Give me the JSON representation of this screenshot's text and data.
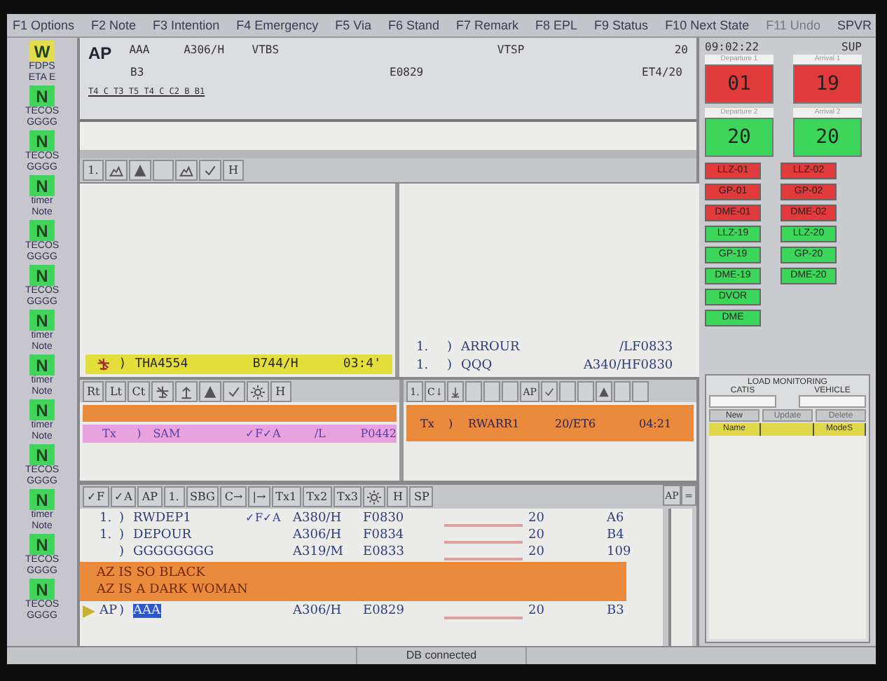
{
  "menu": [
    {
      "label": "F1 Options",
      "disabled": false
    },
    {
      "label": "F2 Note",
      "disabled": false
    },
    {
      "label": "F3 Intention",
      "disabled": false
    },
    {
      "label": "F4 Emergency",
      "disabled": false
    },
    {
      "label": "F5 Via",
      "disabled": false
    },
    {
      "label": "F6 Stand",
      "disabled": false
    },
    {
      "label": "F7 Remark",
      "disabled": false
    },
    {
      "label": "F8 EPL",
      "disabled": false
    },
    {
      "label": "F9 Status",
      "disabled": false
    },
    {
      "label": "F10 Next State",
      "disabled": false
    },
    {
      "label": "F11 Undo",
      "disabled": true
    },
    {
      "label": "SPVR",
      "disabled": false
    }
  ],
  "strips": [
    {
      "badge": "W",
      "color": "#e4dc4c",
      "line1": "FDPS",
      "line2": "ETA E"
    },
    {
      "badge": "N",
      "color": "#3fd45a",
      "line1": "TECOS",
      "line2": "GGGG"
    },
    {
      "badge": "N",
      "color": "#3fd45a",
      "line1": "TECOS",
      "line2": "GGGG"
    },
    {
      "badge": "N",
      "color": "#3fd45a",
      "line1": "timer",
      "line2": "Note"
    },
    {
      "badge": "N",
      "color": "#3fd45a",
      "line1": "TECOS",
      "line2": "GGGG"
    },
    {
      "badge": "N",
      "color": "#3fd45a",
      "line1": "TECOS",
      "line2": "GGGG"
    },
    {
      "badge": "N",
      "color": "#3fd45a",
      "line1": "timer",
      "line2": "Note"
    },
    {
      "badge": "N",
      "color": "#3fd45a",
      "line1": "timer",
      "line2": "Note"
    },
    {
      "badge": "N",
      "color": "#3fd45a",
      "line1": "timer",
      "line2": "Note"
    },
    {
      "badge": "N",
      "color": "#3fd45a",
      "line1": "TECOS",
      "line2": "GGGG"
    },
    {
      "badge": "N",
      "color": "#3fd45a",
      "line1": "timer",
      "line2": "Note"
    },
    {
      "badge": "N",
      "color": "#3fd45a",
      "line1": "TECOS",
      "line2": "GGGG"
    },
    {
      "badge": "N",
      "color": "#3fd45a",
      "line1": "TECOS",
      "line2": "GGGG"
    }
  ],
  "header": {
    "ap": "AP",
    "callsign": "AAA",
    "type": "A306/H",
    "origin": "VTBS",
    "dest": "VTSP",
    "runway": "20",
    "stand": "B3",
    "eobt": "E0829",
    "state": "ET4/20",
    "route": "T4_C_T3_T5_T4_C_C2_B_B1"
  },
  "toolbar_top": [
    {
      "kind": "text",
      "label": "1."
    },
    {
      "kind": "mountain"
    },
    {
      "kind": "triangle"
    },
    {
      "kind": "blank"
    },
    {
      "kind": "mountain"
    },
    {
      "kind": "check"
    },
    {
      "kind": "text",
      "label": "H"
    }
  ],
  "arrival_strip": {
    "mark": ")",
    "callsign": "THA4554",
    "type": "B744/H",
    "time": "03:4'"
  },
  "sequence_rows": [
    {
      "seq": "1.",
      "mark": ")",
      "callsign": "ARROUR",
      "type": "/L",
      "flight_level": "F0833"
    },
    {
      "seq": "1.",
      "mark": ")",
      "callsign": "QQQ",
      "type": "A340/H",
      "flight_level": "F0830"
    }
  ],
  "toolbar_left": [
    {
      "kind": "text",
      "label": "Rt"
    },
    {
      "kind": "text",
      "label": "Lt"
    },
    {
      "kind": "text",
      "label": "Ct"
    },
    {
      "kind": "cross"
    },
    {
      "kind": "arrow-up"
    },
    {
      "kind": "triangle"
    },
    {
      "kind": "check"
    },
    {
      "kind": "sun"
    },
    {
      "kind": "text",
      "label": "H"
    }
  ],
  "toolbar_right": [
    {
      "kind": "text",
      "label": "1."
    },
    {
      "kind": "text",
      "label": "C↓"
    },
    {
      "kind": "arrow-down"
    },
    {
      "kind": "blank"
    },
    {
      "kind": "blank"
    },
    {
      "kind": "blank"
    },
    {
      "kind": "text",
      "label": "AP"
    },
    {
      "kind": "check"
    },
    {
      "kind": "blank"
    },
    {
      "kind": "blank"
    },
    {
      "kind": "triangle"
    },
    {
      "kind": "blank"
    },
    {
      "kind": "blank"
    }
  ],
  "tx_left": {
    "mode": "Tx",
    "mark": ")",
    "callsign": "SAM",
    "flags": "✓F✓A",
    "type": "/L",
    "slot": "P0442"
  },
  "tx_right": {
    "mode": "Tx",
    "mark": ")",
    "callsign": "RWARR1",
    "state": "20/ET6",
    "time": "04:21"
  },
  "toolbar_bottom": [
    {
      "kind": "text",
      "label": "✓F"
    },
    {
      "kind": "text",
      "label": "✓A"
    },
    {
      "kind": "text",
      "label": "AP"
    },
    {
      "kind": "text",
      "label": "1."
    },
    {
      "kind": "text",
      "label": "SBG"
    },
    {
      "kind": "text",
      "label": "C→"
    },
    {
      "kind": "text",
      "label": "|→"
    },
    {
      "kind": "text",
      "label": "Tx1"
    },
    {
      "kind": "text",
      "label": "Tx2"
    },
    {
      "kind": "text",
      "label": "Tx3"
    },
    {
      "kind": "sun"
    },
    {
      "kind": "text",
      "label": "H"
    },
    {
      "kind": "text",
      "label": "SP"
    }
  ],
  "departures": [
    {
      "kind": "flight",
      "selected": false,
      "seq": "1.",
      "mark": ")",
      "callsign": "RWDEP1",
      "flags": "✓F✓A",
      "type": "A380/H",
      "time": "F0830",
      "runway": "20",
      "stand": "A6"
    },
    {
      "kind": "flight",
      "selected": false,
      "seq": "1.",
      "mark": ")",
      "callsign": "DEPOUR",
      "type": "A306/H",
      "time": "F0834",
      "runway": "20",
      "stand": "B4"
    },
    {
      "kind": "flight",
      "selected": false,
      "mark": ")",
      "callsign": "GGGGGGGG",
      "type": "A319/M",
      "time": "E0833",
      "runway": "20",
      "stand": "109"
    },
    {
      "kind": "remark",
      "lines": [
        "AZ IS SO BLACK",
        "AZ IS A DARK WOMAN"
      ]
    },
    {
      "kind": "flight",
      "selected": true,
      "seq": "AP",
      "mark": ")",
      "callsign": "AAA",
      "type": "A306/H",
      "time": "E0829",
      "runway": "20",
      "stand": "B3"
    }
  ],
  "side_buttons": [
    "AP",
    "="
  ],
  "status_panel": {
    "clock": "09:02:22",
    "role": "SUP",
    "runways": [
      {
        "caption": "Departure 1",
        "value": "01",
        "color": "#e03a3a"
      },
      {
        "caption": "Arrival 1",
        "value": "19",
        "color": "#e03a3a"
      },
      {
        "caption": "Departure 2",
        "value": "20",
        "color": "#3bd65a"
      },
      {
        "caption": "Arrival 2",
        "value": "20",
        "color": "#3bd65a"
      }
    ],
    "navaid_columns": [
      [
        {
          "label": "LLZ-01",
          "color": "#e03a3a"
        },
        {
          "label": "GP-01",
          "color": "#e03a3a"
        },
        {
          "label": "DME-01",
          "color": "#e03a3a"
        },
        {
          "label": "LLZ-19",
          "color": "#3bd65a"
        },
        {
          "label": "GP-19",
          "color": "#3bd65a"
        },
        {
          "label": "DME-19",
          "color": "#3bd65a"
        },
        {
          "label": "DVOR",
          "color": "#3bd65a"
        },
        {
          "label": "DME",
          "color": "#3bd65a"
        }
      ],
      [
        {
          "label": "LLZ-02",
          "color": "#e03a3a"
        },
        {
          "label": "GP-02",
          "color": "#e03a3a"
        },
        {
          "label": "DME-02",
          "color": "#e03a3a"
        },
        {
          "label": "LLZ-20",
          "color": "#3bd65a"
        },
        {
          "label": "GP-20",
          "color": "#3bd65a"
        },
        {
          "label": "DME-20",
          "color": "#3bd65a"
        }
      ]
    ]
  },
  "load_monitoring": {
    "title": "LOAD MONITORING",
    "fields": [
      "CATIS",
      "VEHICLE"
    ],
    "buttons": [
      {
        "label": "New",
        "disabled": false
      },
      {
        "label": "Update",
        "disabled": true
      },
      {
        "label": "Delete",
        "disabled": true
      }
    ],
    "columns": [
      "Name",
      "ModeS"
    ]
  },
  "status_bar": {
    "text": "DB connected"
  }
}
